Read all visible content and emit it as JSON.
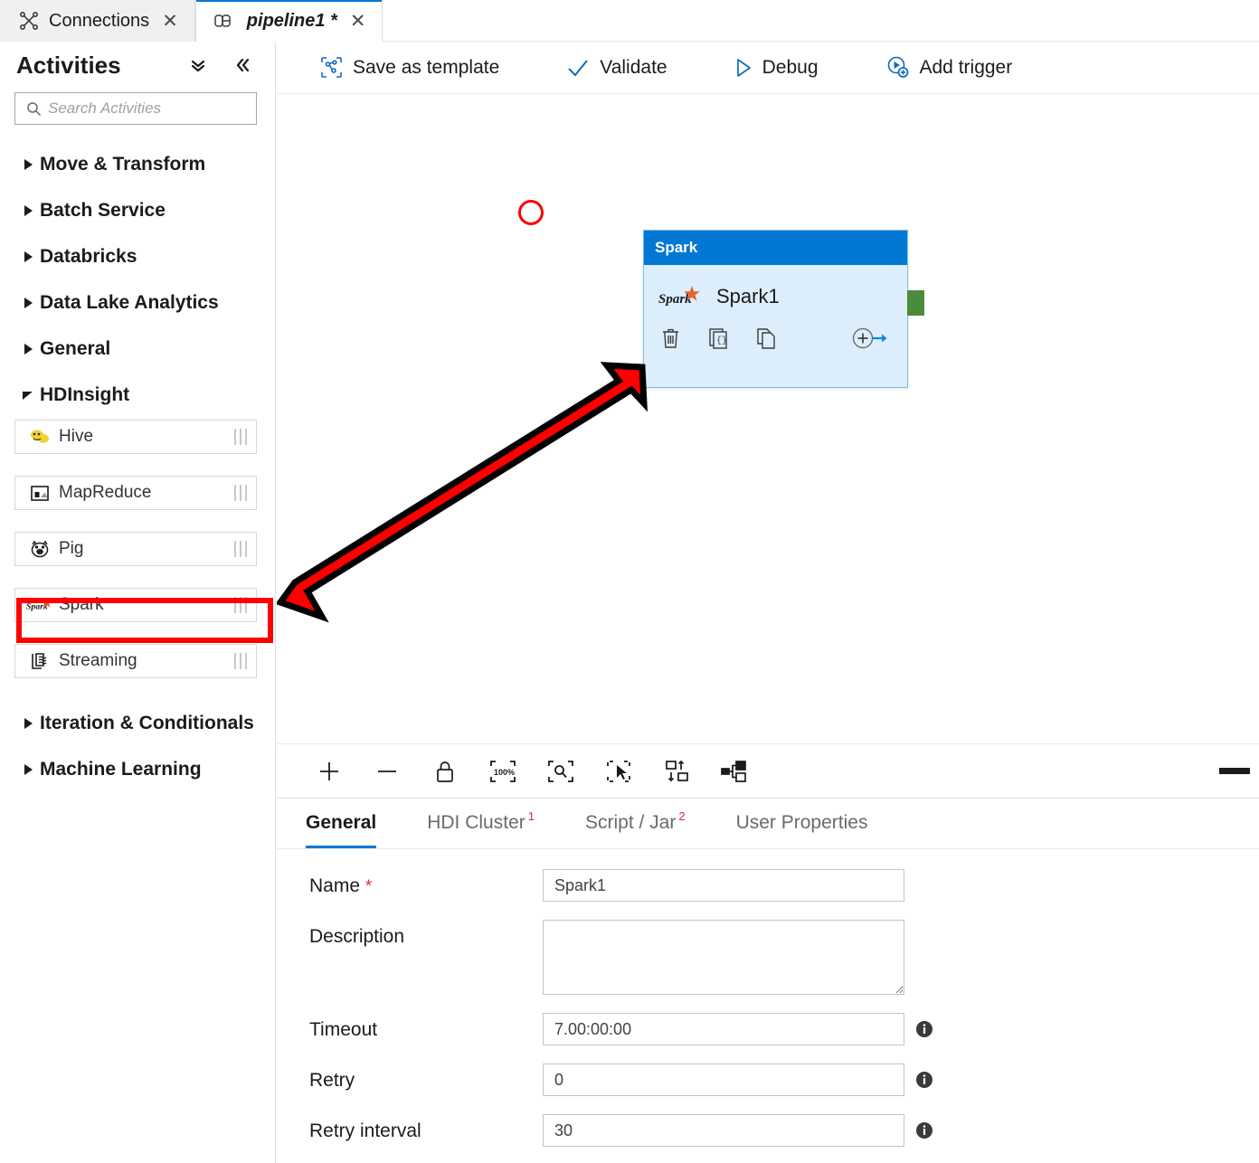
{
  "tabs": [
    {
      "label": "Connections",
      "icon": "connections-icon",
      "active": false,
      "close": "✕"
    },
    {
      "label": "pipeline1 *",
      "icon": "pipeline-icon",
      "active": true,
      "close": "✕"
    }
  ],
  "sidebar": {
    "title": "Activities",
    "collapse_all_icon": "double-chevron-down-icon",
    "collapse_panel_icon": "double-chevron-left-icon",
    "search": {
      "placeholder": "Search Activities",
      "value": "",
      "icon": "search-icon"
    },
    "categories": [
      {
        "label": "Move & Transform",
        "expanded": false
      },
      {
        "label": "Batch Service",
        "expanded": false
      },
      {
        "label": "Databricks",
        "expanded": false
      },
      {
        "label": "Data Lake Analytics",
        "expanded": false
      },
      {
        "label": "General",
        "expanded": false
      },
      {
        "label": "HDInsight",
        "expanded": true
      }
    ],
    "hdinsight_items": [
      {
        "label": "Hive",
        "icon": "hive-icon",
        "highlighted": false
      },
      {
        "label": "MapReduce",
        "icon": "mapreduce-icon",
        "highlighted": false
      },
      {
        "label": "Pig",
        "icon": "pig-icon",
        "highlighted": false
      },
      {
        "label": "Spark",
        "icon": "spark-icon",
        "highlighted": true
      },
      {
        "label": "Streaming",
        "icon": "streaming-icon",
        "highlighted": false
      }
    ],
    "categories_after": [
      {
        "label": "Iteration & Conditionals",
        "expanded": false
      },
      {
        "label": "Machine Learning",
        "expanded": false
      }
    ]
  },
  "toolbar": {
    "buttons": [
      {
        "label": "Save as template",
        "icon": "save-template-icon"
      },
      {
        "label": "Validate",
        "icon": "checkmark-icon"
      },
      {
        "label": "Debug",
        "icon": "play-triangle-icon"
      },
      {
        "label": "Add trigger",
        "icon": "add-trigger-icon"
      }
    ]
  },
  "canvas": {
    "node": {
      "header": "Spark",
      "name": "Spark1",
      "logo_icon": "spark-logo-icon",
      "actions": [
        {
          "name": "delete-activity",
          "icon": "trash-icon"
        },
        {
          "name": "code-activity",
          "icon": "code-braces-icon"
        },
        {
          "name": "clone-activity",
          "icon": "copy-icon"
        },
        {
          "name": "add-output-activity",
          "icon": "add-output-arrow-icon"
        }
      ],
      "output_connector": "output-connector-handle",
      "status_circle": "error-status-circle"
    },
    "annotation": {
      "arrow": "red-annotation-arrow",
      "highlight_box": "red-highlight-box",
      "color": "#ff0000"
    }
  },
  "zoombar": {
    "buttons": [
      {
        "name": "zoom-in-button",
        "icon": "plus-icon"
      },
      {
        "name": "zoom-out-button",
        "icon": "minus-icon"
      },
      {
        "name": "lock-canvas-button",
        "icon": "lock-icon"
      },
      {
        "name": "zoom-to-100-button",
        "icon": "zoom-100-icon",
        "label": "100%"
      },
      {
        "name": "zoom-to-fit-button",
        "icon": "zoom-fit-icon"
      },
      {
        "name": "select-mode-button",
        "icon": "cursor-select-icon"
      },
      {
        "name": "auto-align-button",
        "icon": "auto-align-icon"
      },
      {
        "name": "layout-button",
        "icon": "node-layout-icon"
      }
    ],
    "minimize": "minimize-panel-bar"
  },
  "properties": {
    "tabs": [
      {
        "label": "General",
        "badge": "",
        "active": true
      },
      {
        "label": "HDI Cluster",
        "badge": "1",
        "active": false
      },
      {
        "label": "Script / Jar",
        "badge": "2",
        "active": false
      },
      {
        "label": "User Properties",
        "badge": "",
        "active": false
      }
    ],
    "fields": [
      {
        "label": "Name",
        "required": true,
        "value": "Spark1",
        "type": "text",
        "info": false
      },
      {
        "label": "Description",
        "required": false,
        "value": "",
        "type": "textarea",
        "info": false
      },
      {
        "label": "Timeout",
        "required": false,
        "value": "7.00:00:00",
        "type": "text",
        "info": true
      },
      {
        "label": "Retry",
        "required": false,
        "value": "0",
        "type": "text",
        "info": true
      },
      {
        "label": "Retry interval",
        "required": false,
        "value": "30",
        "type": "text",
        "info": true
      }
    ]
  },
  "colors": {
    "accent": "#0078d4",
    "node_body": "#dceefb",
    "annotation_red": "#ff0000",
    "required_red": "#d13438",
    "connector_green": "#4b8b3b"
  }
}
